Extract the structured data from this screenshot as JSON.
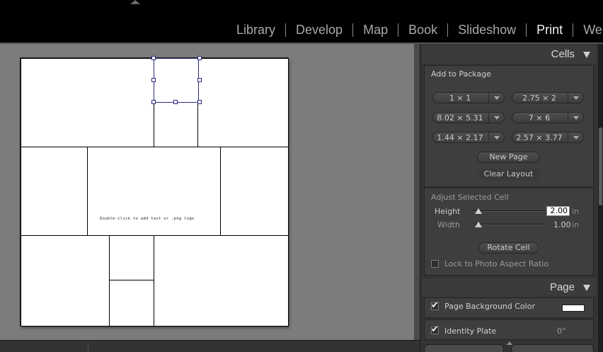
{
  "modules": [
    "Library",
    "Develop",
    "Map",
    "Book",
    "Slideshow",
    "Print",
    "Web"
  ],
  "active_module": "Print",
  "canvas": {
    "cell_hint": "Double-click to add text or .png logo"
  },
  "panels": {
    "cells": {
      "title": "Cells",
      "add_to_package": "Add to Package",
      "sizes": [
        "1 × 1",
        "2.75 × 2",
        "8.02 × 5.31",
        "7 × 6",
        "1.44 × 2.17",
        "2.57 × 3.77"
      ],
      "new_page": "New Page",
      "clear_layout": "Clear Layout",
      "adjust_selected_cell": "Adjust Selected Cell",
      "height_label": "Height",
      "height_value": "2.00",
      "width_label": "Width",
      "width_value": "1.00",
      "unit": "in",
      "height_level": 0.08,
      "width_level": 0.08,
      "rotate_cell": "Rotate Cell",
      "lock_aspect": "Lock to Photo Aspect Ratio",
      "lock_aspect_checked": false
    },
    "page": {
      "title": "Page",
      "page_bg_color": "Page Background Color",
      "page_bg_checked": true,
      "page_bg_swatch": "#ffffff",
      "identity_plate": "Identity Plate",
      "identity_plate_checked": true,
      "identity_angle": "0°"
    }
  },
  "colors": {
    "panel_bg": "#333333",
    "work_bg": "#7c7c7c",
    "selection": "#2a2a80"
  }
}
